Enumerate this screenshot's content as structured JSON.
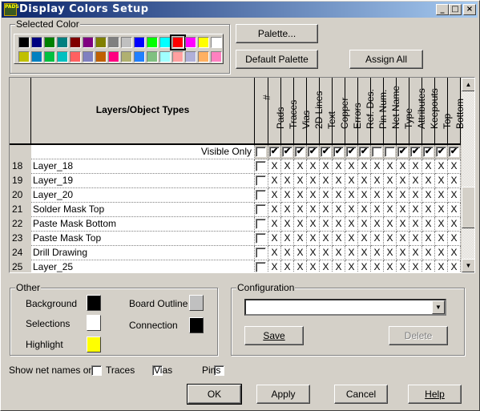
{
  "window": {
    "title": "Display Colors Setup",
    "app_icon_text": "PADS",
    "minimize": "_",
    "maximize": "□",
    "close": "×"
  },
  "selected_color": {
    "label": "Selected Color",
    "selected_index": 12,
    "palette": [
      "#000000",
      "#000080",
      "#008000",
      "#008080",
      "#800000",
      "#800080",
      "#808000",
      "#808080",
      "#c0c0c0",
      "#0000ff",
      "#00ff00",
      "#00ffff",
      "#ff0000",
      "#ff00ff",
      "#ffff00",
      "#ffffff",
      "#c0c000",
      "#0080c0",
      "#00c040",
      "#00c0c0",
      "#ff6060",
      "#8080c0",
      "#c06000",
      "#ff0080",
      "#b0b070",
      "#2080ff",
      "#80c080",
      "#a0ffff",
      "#ffa0a0",
      "#b0b0d8",
      "#ffb060",
      "#ff80c0"
    ]
  },
  "buttons": {
    "palette": "Palette...",
    "default_palette": "Default Palette",
    "assign_all": "Assign All",
    "ok": "OK",
    "apply": "Apply",
    "cancel": "Cancel",
    "help": "Help"
  },
  "grid": {
    "name_header": "Layers/Object Types",
    "hash_header": "#",
    "columns": [
      "Pads",
      "Traces",
      "Vias",
      "2D Lines",
      "Text",
      "Copper",
      "Errors",
      "Ref. Des.",
      "Pin Num.",
      "Net Name",
      "Type",
      "Attributes",
      "Keepouts",
      "Top",
      "Bottom"
    ],
    "visible_only": {
      "label": "Visible Only",
      "hash": false,
      "checks": [
        true,
        true,
        true,
        true,
        true,
        true,
        true,
        true,
        false,
        false,
        true,
        true,
        true,
        true,
        true
      ]
    },
    "cell_mark": "X",
    "rows": [
      {
        "num": "18",
        "name": "Layer_18"
      },
      {
        "num": "19",
        "name": "Layer_19"
      },
      {
        "num": "20",
        "name": "Layer_20"
      },
      {
        "num": "21",
        "name": "Solder Mask Top"
      },
      {
        "num": "22",
        "name": "Paste Mask Bottom"
      },
      {
        "num": "23",
        "name": "Paste Mask Top"
      },
      {
        "num": "24",
        "name": "Drill Drawing"
      },
      {
        "num": "25",
        "name": "Layer_25"
      }
    ]
  },
  "other": {
    "label": "Other",
    "background": {
      "label": "Background",
      "color": "#000000"
    },
    "selections": {
      "label": "Selections",
      "color": "#ffffff"
    },
    "highlight": {
      "label": "Highlight",
      "color": "#ffff00"
    },
    "board_outline": {
      "label": "Board Outline",
      "color": "#c0c0c0"
    },
    "connection": {
      "label": "Connection",
      "color": "#000000"
    }
  },
  "configuration": {
    "label": "Configuration",
    "value": "",
    "save": "Save",
    "delete": "Delete"
  },
  "net_names": {
    "label": "Show net names on",
    "traces": "Traces",
    "vias": "Vias",
    "pins": "Pins",
    "traces_checked": false,
    "vias_checked": false,
    "pins_checked": false
  }
}
